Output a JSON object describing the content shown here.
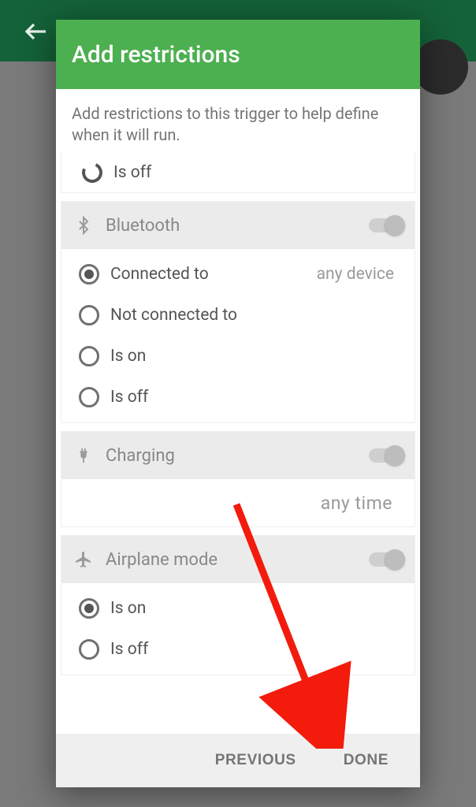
{
  "dialog": {
    "title": "Add restrictions",
    "description": "Add restrictions to this trigger to help define when it will run.",
    "footer": {
      "previous": "PREVIOUS",
      "done": "DONE"
    }
  },
  "partial_first_option": {
    "label": "Is off"
  },
  "sections": {
    "bluetooth": {
      "label": "Bluetooth",
      "enabled": false,
      "options": [
        {
          "label": "Connected to",
          "selected": true,
          "value": "any device"
        },
        {
          "label": "Not connected to",
          "selected": false
        },
        {
          "label": "Is on",
          "selected": false
        },
        {
          "label": "Is off",
          "selected": false
        }
      ]
    },
    "charging": {
      "label": "Charging",
      "enabled": false,
      "value": "any time"
    },
    "airplane": {
      "label": "Airplane mode",
      "enabled": false,
      "options": [
        {
          "label": "Is on",
          "selected": true
        },
        {
          "label": "Is off",
          "selected": false
        }
      ]
    }
  }
}
